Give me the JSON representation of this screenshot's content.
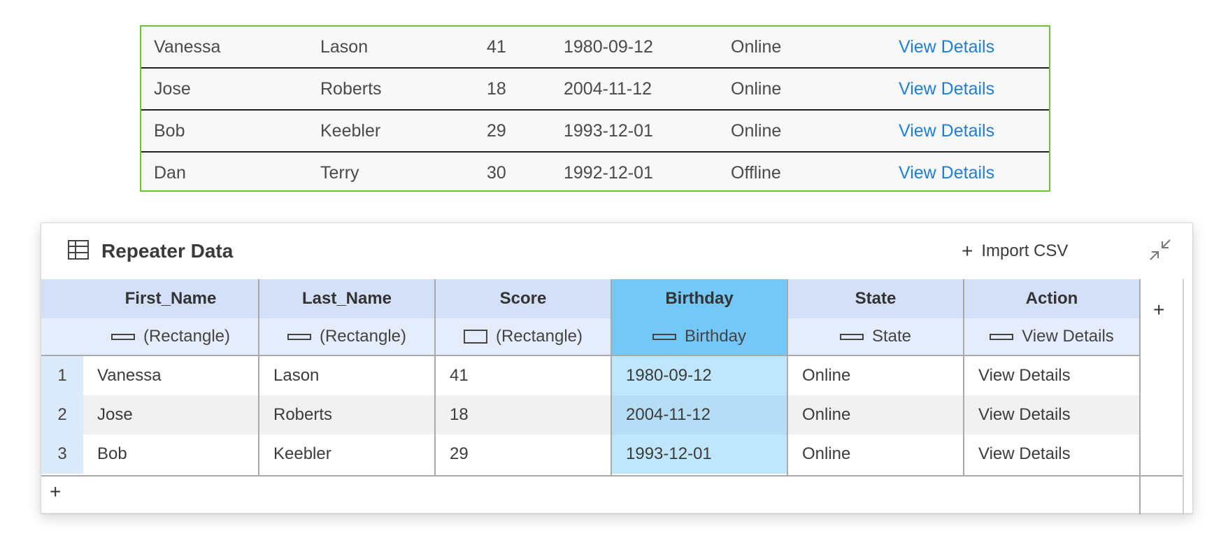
{
  "preview": {
    "rows": [
      {
        "first": "Vanessa",
        "last": "Lason",
        "score": "41",
        "birthday": "1980-09-12",
        "state": "Online",
        "action": "View Details"
      },
      {
        "first": "Jose",
        "last": "Roberts",
        "score": "18",
        "birthday": "2004-11-12",
        "state": "Online",
        "action": "View Details"
      },
      {
        "first": "Bob",
        "last": "Keebler",
        "score": "29",
        "birthday": "1993-12-01",
        "state": "Online",
        "action": "View Details"
      },
      {
        "first": "Dan",
        "last": "Terry",
        "score": "30",
        "birthday": "1992-12-01",
        "state": "Offline",
        "action": "View Details"
      }
    ],
    "border_color": "#71c13a",
    "link_color": "#1f7ed8"
  },
  "panel": {
    "title": "Repeater Data",
    "title_icon": "table-icon",
    "import_plus": "+",
    "import_label": "Import CSV",
    "collapse_icon": "collapse-icon",
    "add_row": "+",
    "add_column": "+"
  },
  "columns": [
    {
      "name": "First_Name",
      "binding": "(Rectangle)",
      "icon": "rectangle-thin-icon",
      "selected": false
    },
    {
      "name": "Last_Name",
      "binding": "(Rectangle)",
      "icon": "rectangle-thin-icon",
      "selected": false
    },
    {
      "name": "Score",
      "binding": "(Rectangle)",
      "icon": "rectangle-icon",
      "selected": false
    },
    {
      "name": "Birthday",
      "binding": "Birthday",
      "icon": "rectangle-thin-icon",
      "selected": true
    },
    {
      "name": "State",
      "binding": "State",
      "icon": "rectangle-thin-icon",
      "selected": false
    },
    {
      "name": "Action",
      "binding": "View Details",
      "icon": "rectangle-thin-icon",
      "selected": false
    }
  ],
  "rows": [
    {
      "index": "1",
      "cells": [
        "Vanessa",
        "Lason",
        "41",
        "1980-09-12",
        "Online",
        "View Details"
      ]
    },
    {
      "index": "2",
      "cells": [
        "Jose",
        "Roberts",
        "18",
        "2004-11-12",
        "Online",
        "View Details"
      ]
    },
    {
      "index": "3",
      "cells": [
        "Bob",
        "Keebler",
        "29",
        "1993-12-01",
        "Online",
        "View Details"
      ]
    }
  ],
  "colors": {
    "header_bg": "#d3e0f7",
    "selected_header_bg": "#74c8f8",
    "selected_cell_bg": "#c0e6fc"
  }
}
